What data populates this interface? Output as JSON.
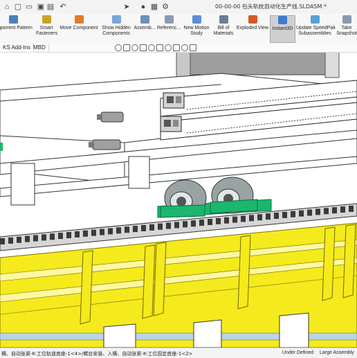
{
  "app": {
    "window_title": "00-00-00 包头轨枕自动化生产线.SLDASM *"
  },
  "quick_access": [
    {
      "name": "home-icon",
      "glyph": "⌂"
    },
    {
      "name": "new-document-icon",
      "glyph": "▢"
    },
    {
      "name": "open-folder-icon",
      "glyph": "▭"
    },
    {
      "name": "save-icon",
      "glyph": "▣"
    },
    {
      "name": "print-icon",
      "glyph": "▤"
    },
    {
      "name": "undo-icon",
      "glyph": "↶"
    },
    {
      "name": "select-arrow-icon",
      "glyph": "➤"
    },
    {
      "name": "rebuild-icon",
      "glyph": "●"
    },
    {
      "name": "file-properties-icon",
      "glyph": "▦"
    },
    {
      "name": "options-gear-icon",
      "glyph": "⚙"
    }
  ],
  "ribbon": {
    "buttons": [
      {
        "id": "linear-component-pattern",
        "label": "omponent Pattern",
        "icon_color": "#4a7fc0",
        "active": false
      },
      {
        "id": "smart-fasteners",
        "label": "Smart\nFasteners",
        "icon_color": "#c9a227",
        "active": false
      },
      {
        "id": "move-component",
        "label": "Move Component",
        "icon_color": "#e07b2a",
        "active": false
      },
      {
        "id": "show-hidden-components",
        "label": "Show Hidden\nComponents",
        "icon_color": "#7aa6d8",
        "active": false
      },
      {
        "id": "assembly-features",
        "label": "Assemb...",
        "icon_color": "#6e8fb5",
        "active": false
      },
      {
        "id": "reference-geometry",
        "label": "Referenc...",
        "icon_color": "#8a9ab0",
        "active": false
      },
      {
        "id": "new-motion-study",
        "label": "New Motion\nStudy",
        "icon_color": "#5b8fd1",
        "active": false
      },
      {
        "id": "bill-of-materials",
        "label": "Bill of\nMaterials",
        "icon_color": "#6c7d93",
        "active": false
      },
      {
        "id": "exploded-view",
        "label": "Exploded View",
        "icon_color": "#d45a2a",
        "active": false
      },
      {
        "id": "instant3d",
        "label": "Instant3D",
        "icon_color": "#3d7bd0",
        "active": true
      },
      {
        "id": "update-speedpak-subassemblies",
        "label": "Update SpeedPak\nSubassemblies",
        "icon_color": "#58a0d6",
        "active": false
      },
      {
        "id": "take-snapshot",
        "label": "Take\nSnapshot",
        "icon_color": "#889ab0",
        "active": false
      }
    ]
  },
  "tabs": [
    {
      "id": "solidworks-addins",
      "label": "KS Add-Ins"
    },
    {
      "id": "mbd",
      "label": "MBD"
    }
  ],
  "view_toolbar": [
    "zoom-to-fit-icon",
    "zoom-area-icon",
    "previous-view-icon",
    "section-view-icon",
    "view-orientation-icon",
    "display-style-icon",
    "hide-show-icon",
    "edit-appearance-icon",
    "scene-icon",
    "view-settings-icon"
  ],
  "status": {
    "selection": "横、自动张紧-K-工位轨道底座-1<4>/螺丝安装、入横、自动张紧-K-工位固定底座-1<2>",
    "definition": "Under Defined",
    "mode": "Large Assembly"
  },
  "colors": {
    "conveyor_yellow": "#f5ea1c",
    "bearing_green": "#1bb76e",
    "wheel_gray": "#9aa3a3",
    "chain_dark": "#3a3a3a",
    "frame_white": "#ffffff",
    "cylinder_blue": "#b8d4e6"
  }
}
